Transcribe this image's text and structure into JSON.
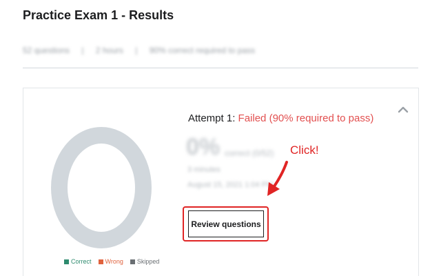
{
  "page": {
    "title": "Practice Exam 1 - Results",
    "meta": [
      "52 questions",
      "|",
      "2 hours",
      "|",
      "90% correct required to pass"
    ]
  },
  "card": {
    "attempt_label": "Attempt 1:",
    "attempt_status": "Failed (90% required to pass)",
    "score": "0%",
    "score_detail": "correct (0/52)",
    "duration": "3 minutes",
    "date": "August 15, 2021 1:04 PM",
    "review_button_label": "Review questions",
    "chart": {
      "legend": [
        {
          "label": "Correct",
          "color": "#2e8b6e"
        },
        {
          "label": "Wrong",
          "color": "#e0633e"
        },
        {
          "label": "Skipped",
          "color": "#6a6f73"
        }
      ],
      "ring_color": "#d1d7dc",
      "icon": "donut-chart"
    },
    "collapse_icon": "chevron-up-icon"
  },
  "annotation": {
    "text": "Click!",
    "color": "#e02424"
  }
}
